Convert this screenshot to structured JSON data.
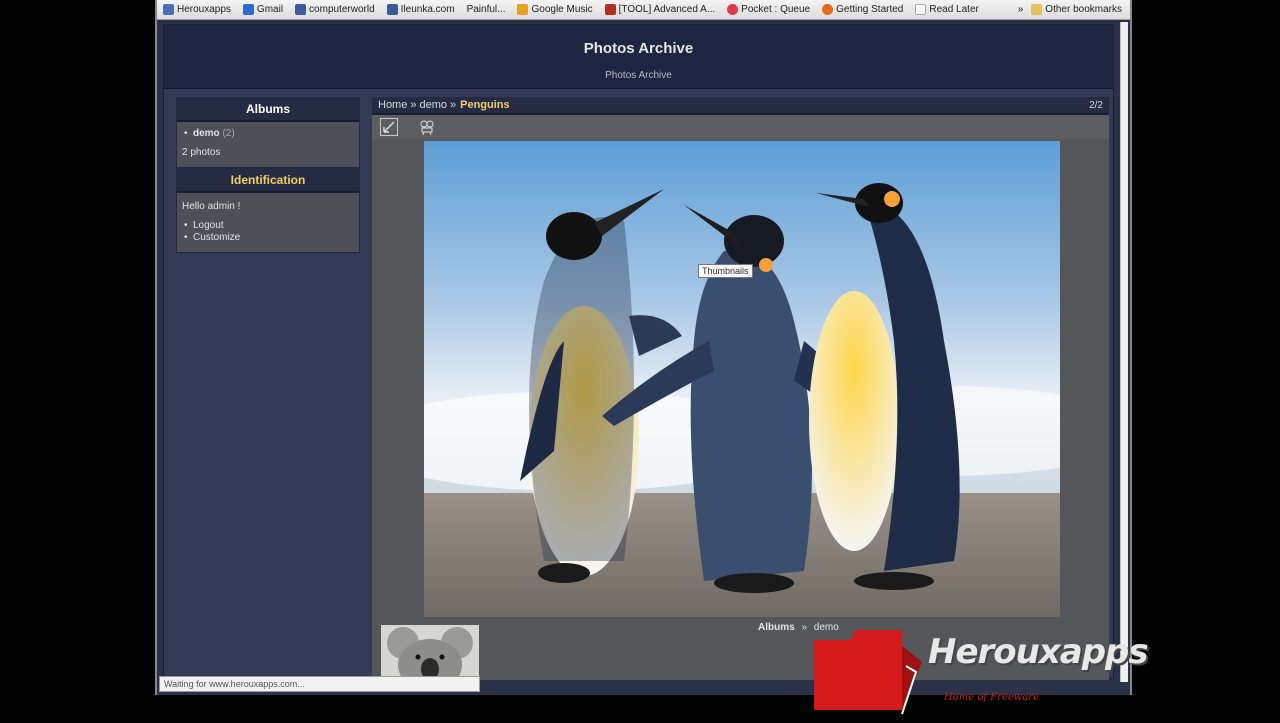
{
  "bookmarks": [
    {
      "label": "Herouxapps",
      "color": "#4a6fb5"
    },
    {
      "label": "Gmail",
      "color": "#2e6ad6"
    },
    {
      "label": "computerworld",
      "color": "#3b5b9a"
    },
    {
      "label": "Ileunka.com",
      "color": "#3b5998"
    },
    {
      "label": "Painful...",
      "color": "#999999"
    },
    {
      "label": "Google Music",
      "color": "#e8a020"
    },
    {
      "label": "[TOOL] Advanced A...",
      "color": "#b03020"
    },
    {
      "label": "Pocket : Queue",
      "color": "#e03a4a"
    },
    {
      "label": "Getting Started",
      "color": "#e56a1a"
    },
    {
      "label": "Read Later",
      "color": "#cccccc"
    }
  ],
  "bookmarks_other": "Other bookmarks",
  "header": {
    "title": "Photos Archive",
    "subtitle": "Photos Archive"
  },
  "sidebar": {
    "albums_title": "Albums",
    "album_item": "demo",
    "album_count": "(2)",
    "photos_count": "2 photos",
    "ident_title": "Identification",
    "greeting": "Hello admin !",
    "links": [
      "Logout",
      "Customize"
    ]
  },
  "breadcrumb": {
    "home": "Home",
    "sep": "»",
    "album": "demo",
    "current": "Penguins",
    "counter": "2/2"
  },
  "photo": {
    "tooltip": "Thumbnails",
    "subject": "penguins-photo"
  },
  "footer": {
    "albums_label": "Albums",
    "sep": "»",
    "album": "demo"
  },
  "status": "Waiting for www.herouxapps.com...",
  "logo": {
    "name": "Herouxapps",
    "tagline": "Home of Freeware",
    "accent": "#d41a1a"
  }
}
